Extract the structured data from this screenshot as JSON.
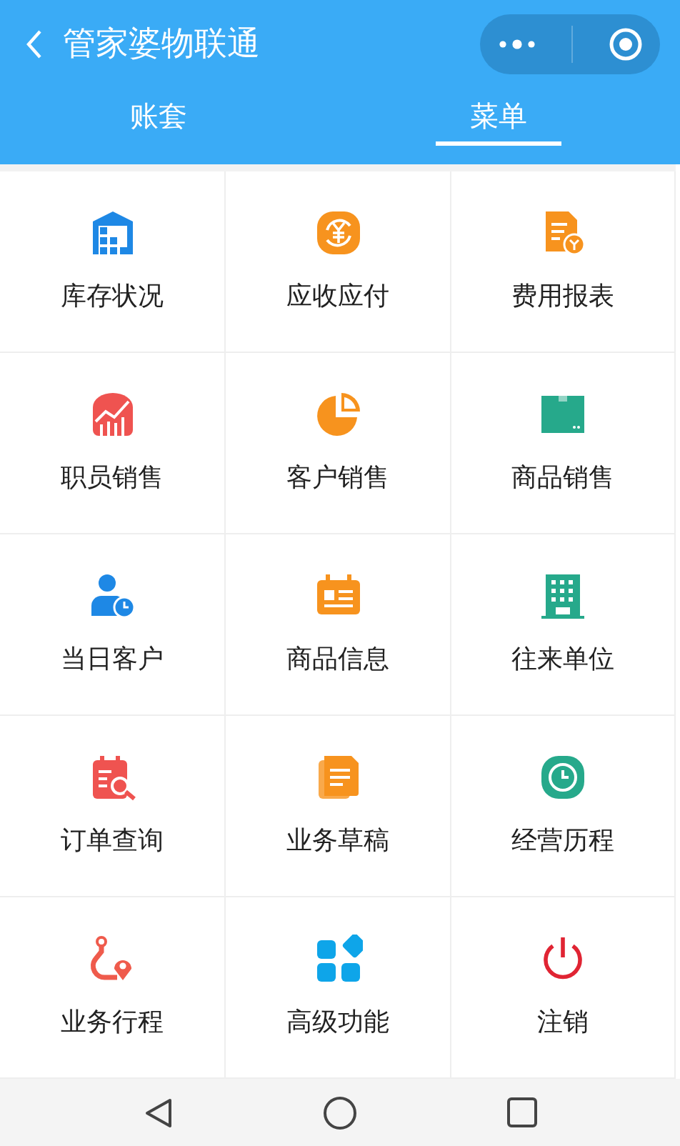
{
  "header": {
    "title": "管家婆物联通"
  },
  "tabs": [
    {
      "label": "账套",
      "selected": false
    },
    {
      "label": "菜单",
      "selected": true
    }
  ],
  "menu": [
    {
      "label": "库存状况",
      "color": "#1e88e5"
    },
    {
      "label": "应收应付",
      "color": "#f7931e"
    },
    {
      "label": "费用报表",
      "color": "#f7931e"
    },
    {
      "label": "职员销售",
      "color": "#ef5350"
    },
    {
      "label": "客户销售",
      "color": "#f7931e"
    },
    {
      "label": "商品销售",
      "color": "#26a98b"
    },
    {
      "label": "当日客户",
      "color": "#1e88e5"
    },
    {
      "label": "商品信息",
      "color": "#f7931e"
    },
    {
      "label": "往来单位",
      "color": "#26a98b"
    },
    {
      "label": "订单查询",
      "color": "#ef5350"
    },
    {
      "label": "业务草稿",
      "color": "#f7931e"
    },
    {
      "label": "经营历程",
      "color": "#26a98b"
    },
    {
      "label": "业务行程",
      "color": "#ef5b4c"
    },
    {
      "label": "高级功能",
      "color": "#0ea5e9"
    },
    {
      "label": "注销",
      "color": "#e02433"
    }
  ]
}
